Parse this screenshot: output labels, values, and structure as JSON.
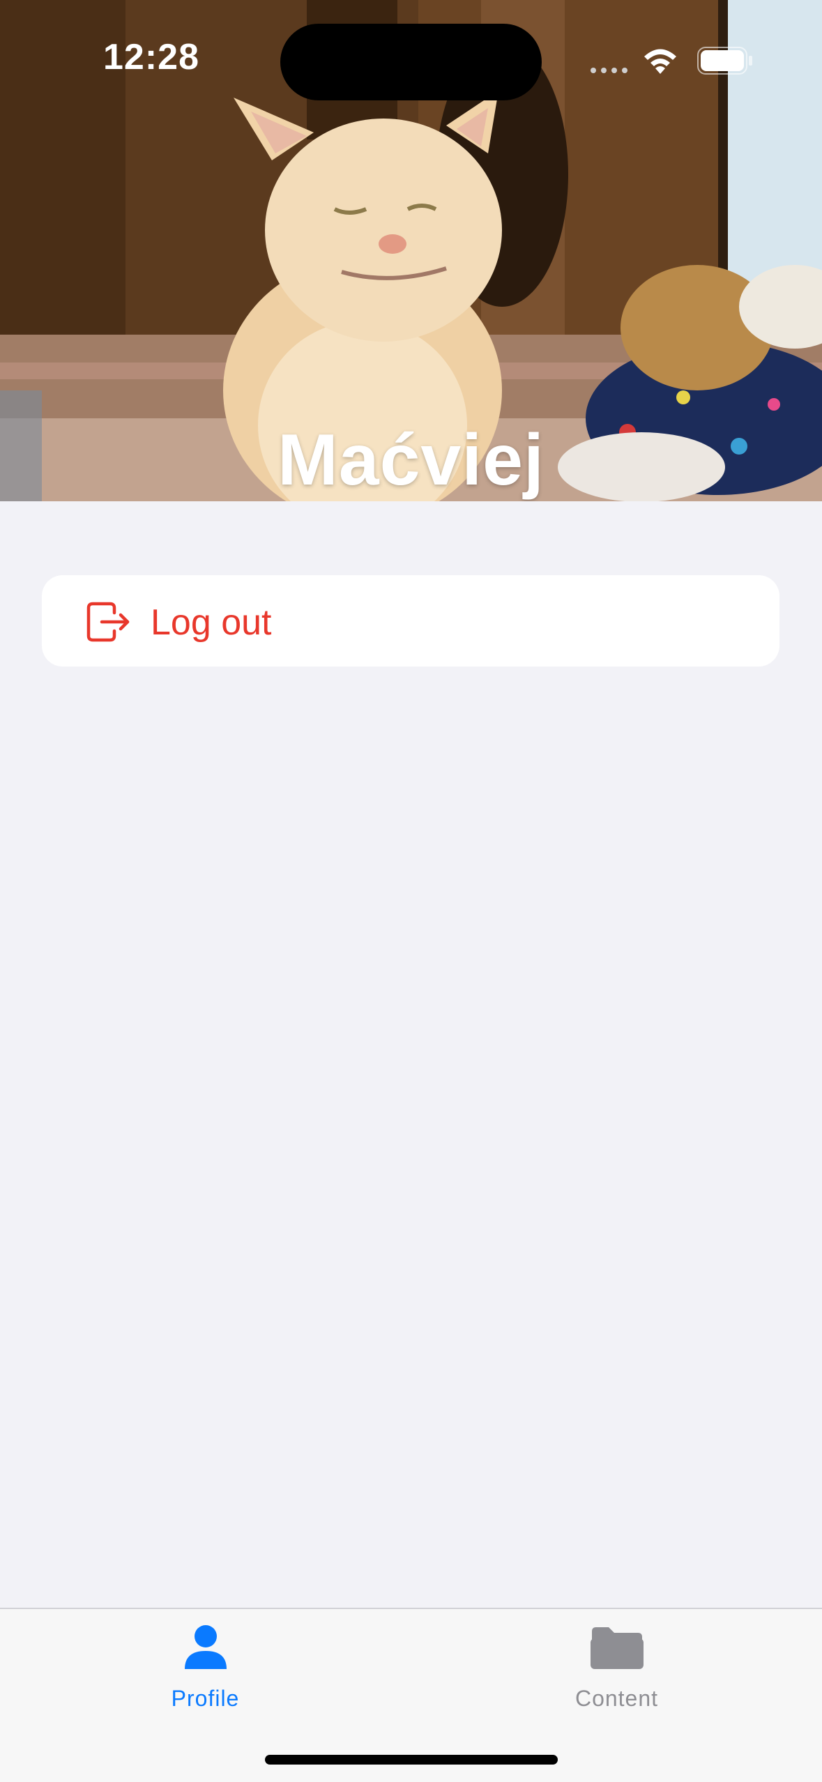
{
  "status_bar": {
    "time": "12:28"
  },
  "profile": {
    "name": "Maćviej"
  },
  "settings": {
    "logout_label": "Log out",
    "logout_icon": "logout-arrow-icon",
    "logout_color": "#e8372b"
  },
  "tab_bar": {
    "tabs": [
      {
        "label": "Profile",
        "icon": "person-icon",
        "selected": true
      },
      {
        "label": "Content",
        "icon": "folder-icon",
        "selected": false
      }
    ],
    "active_color": "#0a7aff",
    "inactive_color": "#8e8e93"
  },
  "colors": {
    "background": "#f2f2f7",
    "card": "#ffffff"
  }
}
